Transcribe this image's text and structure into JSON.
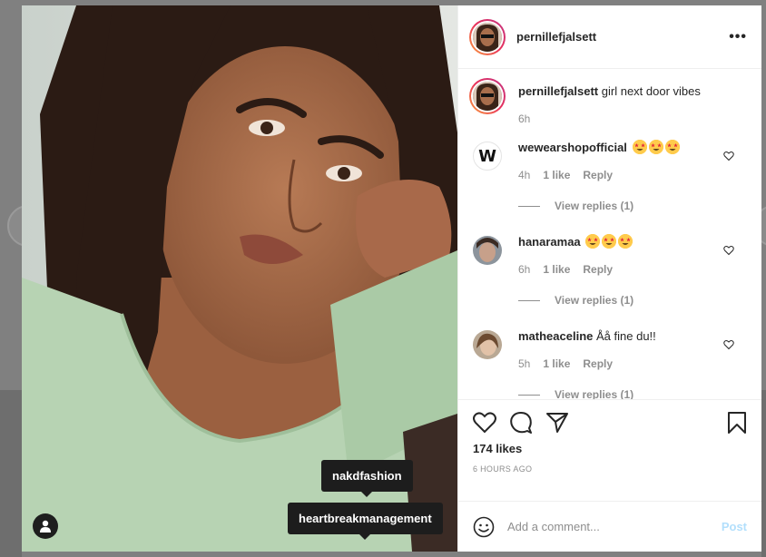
{
  "post": {
    "author": "pernillefjalsett",
    "more_label": "•••",
    "caption_text": "girl next door vibes",
    "caption_time": "6h"
  },
  "photo_tags": [
    "nakdfashion",
    "heartbreakmanagement"
  ],
  "comments": [
    {
      "username": "wewearshopofficial",
      "text": "",
      "emoji_count": 3,
      "time": "4h",
      "likes": "1 like",
      "reply_label": "Reply",
      "view_replies": "View replies (1)",
      "avatar_letter": "W"
    },
    {
      "username": "hanaramaa",
      "text": "",
      "emoji_count": 3,
      "time": "6h",
      "likes": "1 like",
      "reply_label": "Reply",
      "view_replies": "View replies (1)"
    },
    {
      "username": "matheaceline",
      "text": "Åå fine du!!",
      "time": "5h",
      "likes": "1 like",
      "reply_label": "Reply",
      "view_replies": "View replies (1)"
    }
  ],
  "actions": {
    "likes_count": "174 likes",
    "time_ago": "6 HOURS AGO"
  },
  "composer": {
    "placeholder": "Add a comment...",
    "post_label": "Post"
  },
  "colors": {
    "accent_disabled": "#b2dffc",
    "muted_text": "#8e8e8e",
    "tag_bg": "#1d1d1d",
    "sweater": "#b7d3b3"
  }
}
